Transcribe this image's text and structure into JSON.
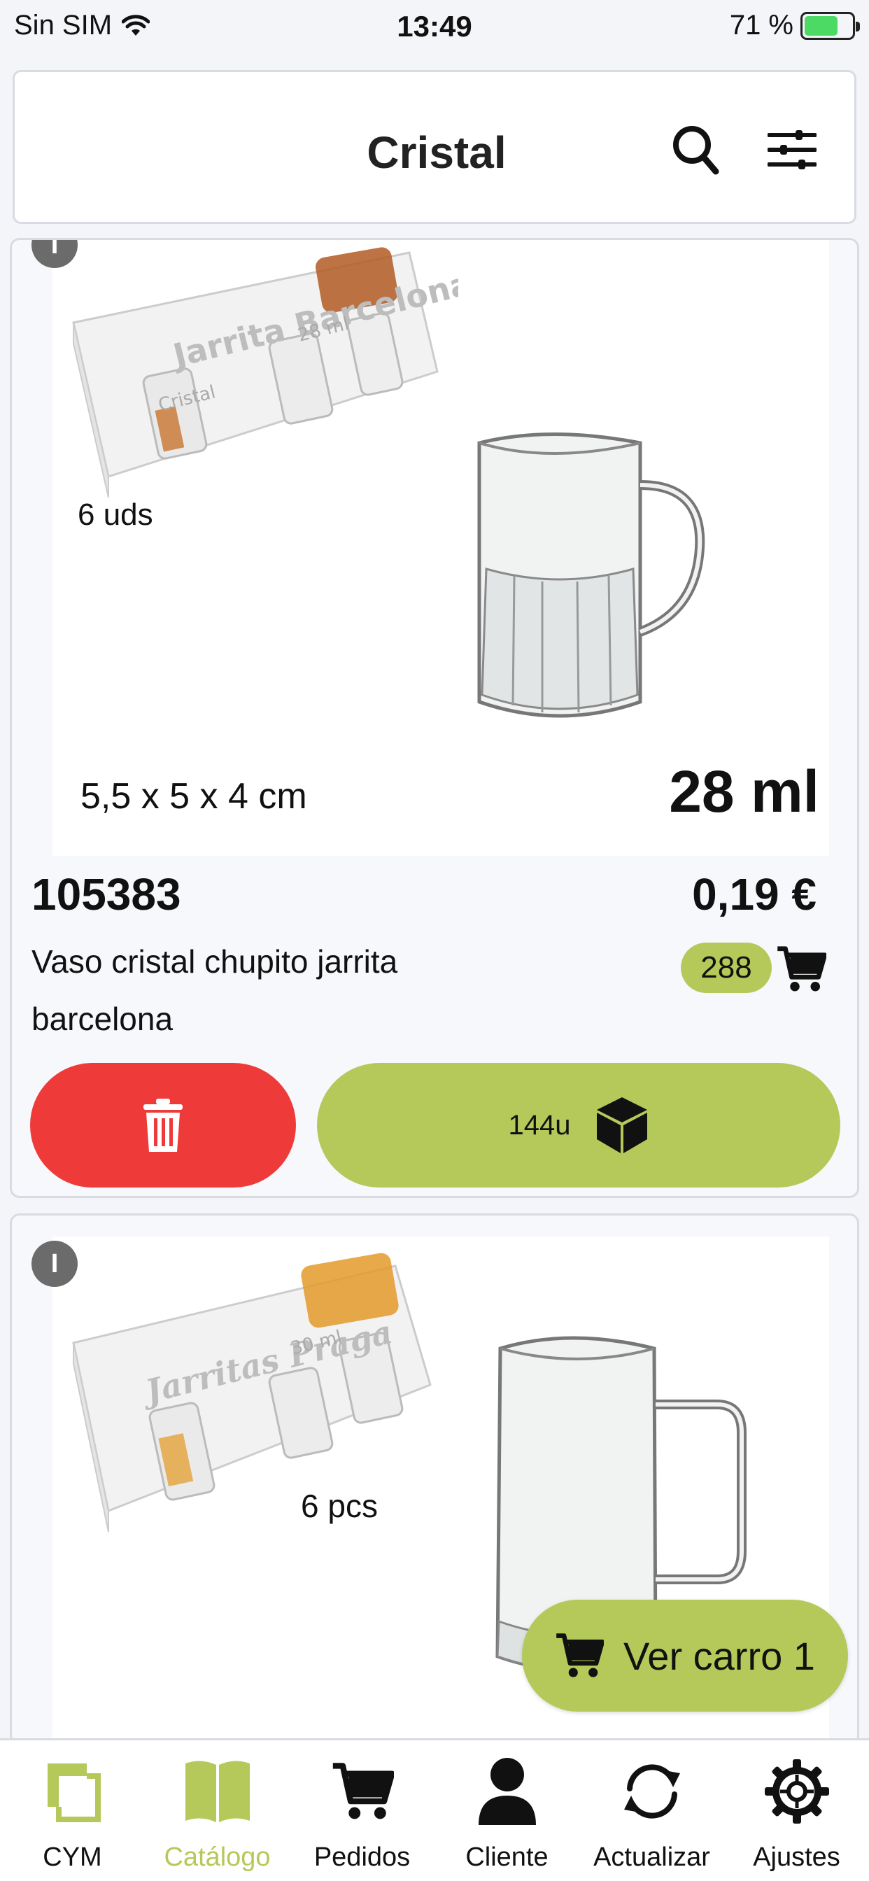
{
  "status_bar": {
    "carrier": "Sin SIM",
    "time": "13:49",
    "battery": "71 %",
    "battery_level": 0.71
  },
  "header": {
    "title": "Cristal",
    "search_icon": "search-icon",
    "filter_icon": "sliders-icon"
  },
  "products": [
    {
      "badge": "I",
      "image": {
        "box_brand": "Jarrita Barcelona",
        "box_line2": "Cristal",
        "box_vol": "28 ml",
        "units_label": "6 uds",
        "dimensions": "5,5 x 5 x 4 cm",
        "volume": "28 ml"
      },
      "code": "105383",
      "price": "0,19 €",
      "name": "Vaso cristal chupito jarrita barcelona",
      "stock": "288",
      "pack_label": "144u"
    },
    {
      "badge": "I",
      "image": {
        "box_brand": "Jarritas Praga",
        "box_vol": "30 ml",
        "units_label": "6 pcs"
      }
    }
  ],
  "cart_button": {
    "label": "Ver carro 1"
  },
  "colors": {
    "accent": "#b5c95a",
    "danger": "#ee3b3a"
  },
  "nav": [
    {
      "label": "CYM",
      "icon": "cym-logo-icon"
    },
    {
      "label": "Catálogo",
      "icon": "book-icon",
      "active": true
    },
    {
      "label": "Pedidos",
      "icon": "cart-icon"
    },
    {
      "label": "Cliente",
      "icon": "user-icon"
    },
    {
      "label": "Actualizar",
      "icon": "refresh-icon"
    },
    {
      "label": "Ajustes",
      "icon": "gear-icon"
    }
  ]
}
